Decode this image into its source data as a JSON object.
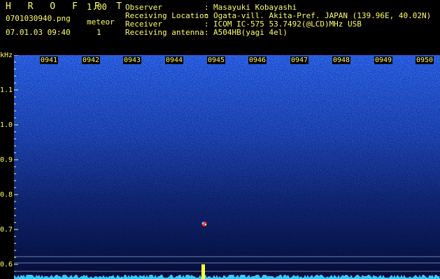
{
  "header": {
    "app_name": "H R O F F T",
    "version": "1.00",
    "filename": "0701030940.png",
    "meteor_label": "meteor",
    "meteor_count": "1",
    "datetime": "07.01.03 09:40",
    "fields": [
      {
        "label": "Observer",
        "value": "Masayuki Kobayashi"
      },
      {
        "label": "Receiving Location",
        "value": "Ogata-vill. Akita-Pref. JAPAN (139.96E, 40.02N)"
      },
      {
        "label": "Receiver",
        "value": "ICOM IC-575 53.7492(@LCD)MHz USB"
      },
      {
        "label": "Receiving antenna",
        "value": "A504HB(yagi 4el)"
      }
    ],
    "colon": ":"
  },
  "axis": {
    "unit": "kHz",
    "y_labels": [
      "1.1",
      "1.0",
      "0.9",
      "0.8",
      "0.7",
      "0.6"
    ],
    "x_labels": [
      "0941",
      "0942",
      "0943",
      "0944",
      "0945",
      "0946",
      "0947",
      "0948",
      "0949",
      "0950"
    ]
  },
  "colors": {
    "text": "#ffff66",
    "background": "#000000",
    "noise_high": "#2a6fff",
    "noise_low": "#08124a",
    "echo": "#ff3333",
    "baseline": "#33ccff"
  },
  "meteor_echo": {
    "time": "0945",
    "frequency_khz": "0.72"
  }
}
